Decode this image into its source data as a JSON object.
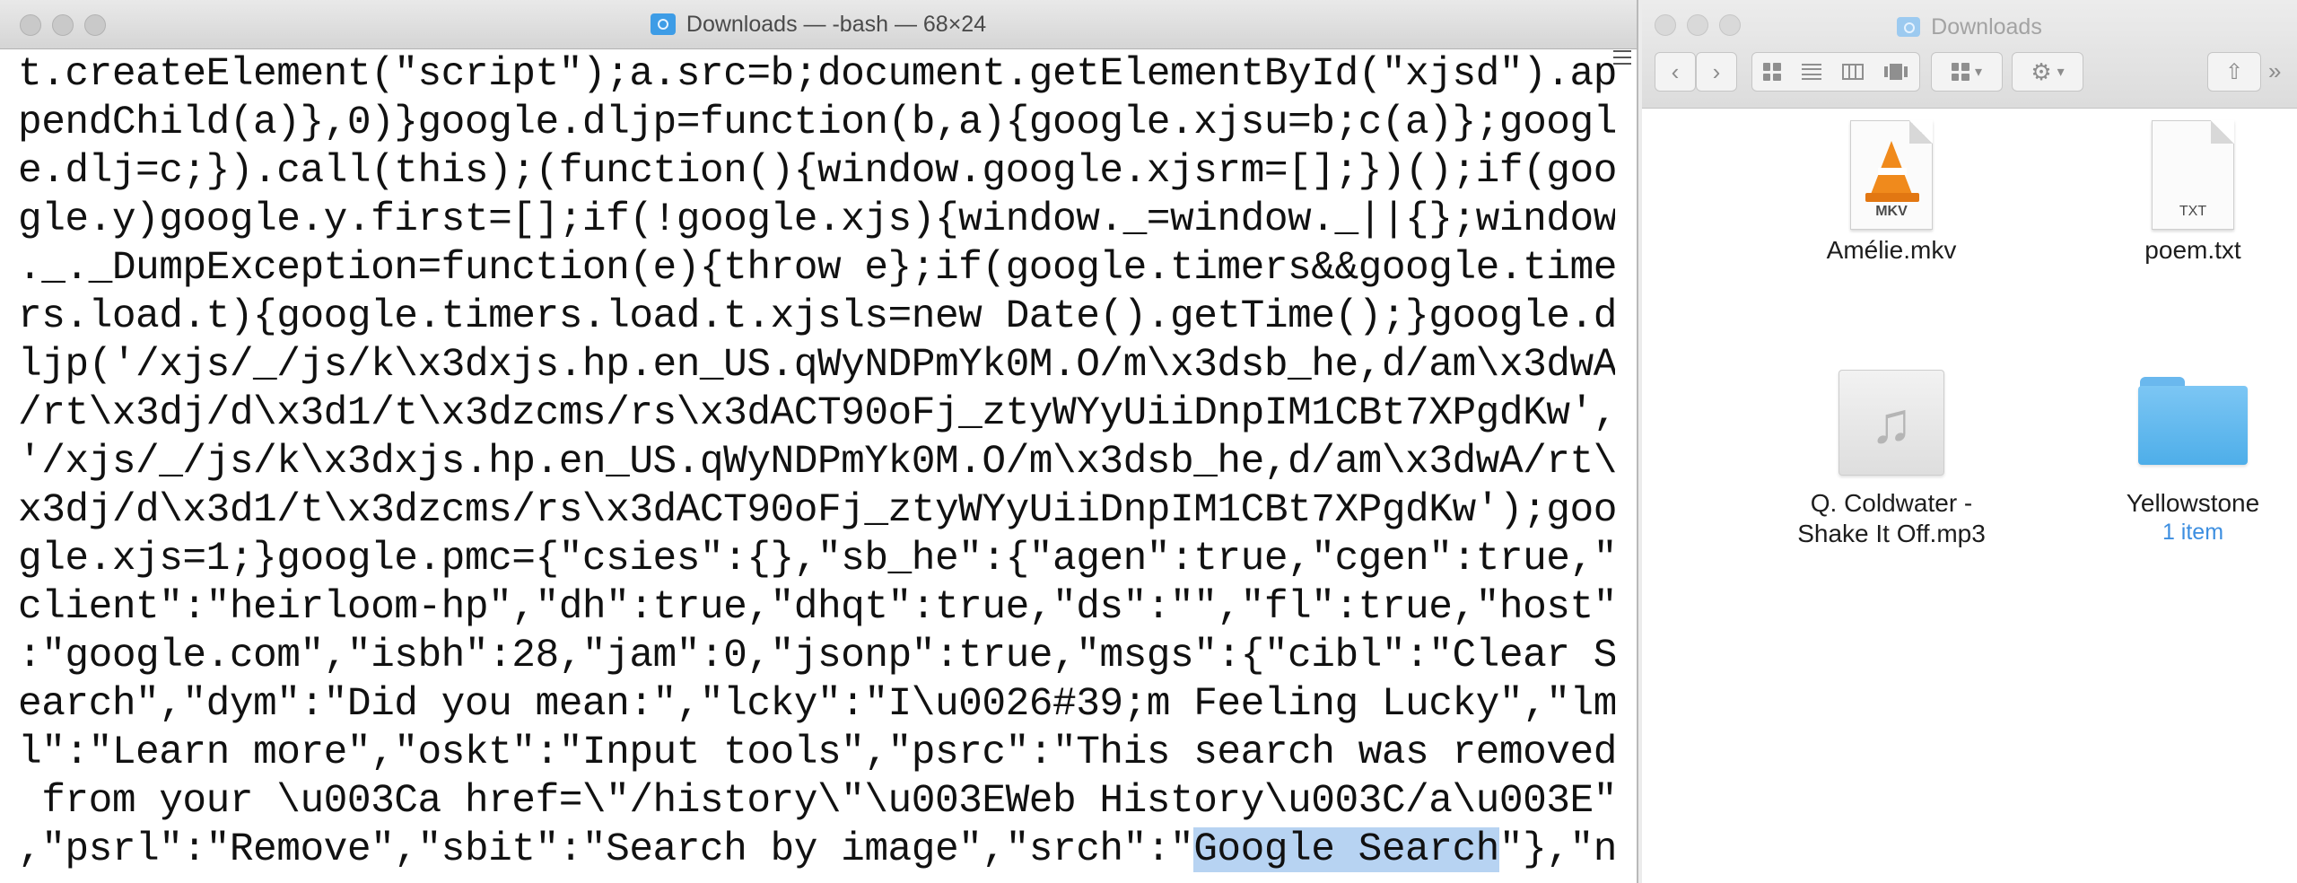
{
  "terminal": {
    "title": "Downloads — -bash — 68×24",
    "lines": [
      "t.createElement(\"script\");a.src=b;document.getElementById(\"xjsd\").ap",
      "pendChild(a)},0)}google.dljp=function(b,a){google.xjsu=b;c(a)};googl",
      "e.dlj=c;}).call(this);(function(){window.google.xjsrm=[];})();if(goo",
      "gle.y)google.y.first=[];if(!google.xjs){window._=window._||{};window",
      "._._DumpException=function(e){throw e};if(google.timers&&google.time",
      "rs.load.t){google.timers.load.t.xjsls=new Date().getTime();}google.d",
      "ljp('/xjs/_/js/k\\x3dxjs.hp.en_US.qWyNDPmYk0M.O/m\\x3dsb_he,d/am\\x3dwA",
      "/rt\\x3dj/d\\x3d1/t\\x3dzcms/rs\\x3dACT90oFj_ztyWYyUiiDnpIM1CBt7XPgdKw',",
      "'/xjs/_/js/k\\x3dxjs.hp.en_US.qWyNDPmYk0M.O/m\\x3dsb_he,d/am\\x3dwA/rt\\",
      "x3dj/d\\x3d1/t\\x3dzcms/rs\\x3dACT90oFj_ztyWYyUiiDnpIM1CBt7XPgdKw');goo",
      "gle.xjs=1;}google.pmc={\"csies\":{},\"sb_he\":{\"agen\":true,\"cgen\":true,\"",
      "client\":\"heirloom-hp\",\"dh\":true,\"dhqt\":true,\"ds\":\"\",\"fl\":true,\"host\"",
      ":\"google.com\",\"isbh\":28,\"jam\":0,\"jsonp\":true,\"msgs\":{\"cibl\":\"Clear S",
      "earch\",\"dym\":\"Did you mean:\",\"lcky\":\"I\\u0026#39;m Feeling Lucky\",\"lm",
      "l\":\"Learn more\",\"oskt\":\"Input tools\",\"psrc\":\"This search was removed",
      " from your \\u003Ca href=\\\"/history\\\"\\u003EWeb History\\u003C/a\\u003E\"",
      ",\"psrl\":\"Remove\",\"sbit\":\"Search by image\",\"srch\":\"",
      "\"},\"n"
    ],
    "highlighted_text": "Google Search"
  },
  "finder": {
    "title": "Downloads",
    "toolbar": {
      "back_icon": "chevron-left-icon",
      "forward_icon": "chevron-right-icon"
    },
    "files": [
      {
        "name": "Amélie.mkv",
        "badge": "MKV",
        "kind": "video"
      },
      {
        "name": "poem.txt",
        "badge": "TXT",
        "kind": "text"
      },
      {
        "name": "Q. Coldwater - Shake It Off.mp3",
        "line1": "Q. Coldwater -",
        "line2": "Shake It Off.mp3",
        "kind": "audio"
      },
      {
        "name": "Yellowstone",
        "subtitle": "1 item",
        "kind": "folder"
      }
    ]
  }
}
